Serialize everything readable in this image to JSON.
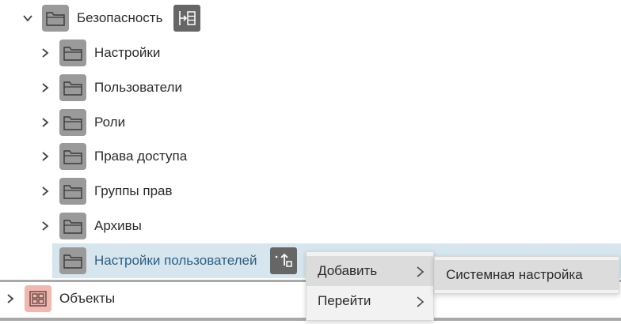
{
  "tree": {
    "root": {
      "label": "Безопасность"
    },
    "children": [
      {
        "label": "Настройки"
      },
      {
        "label": "Пользователи"
      },
      {
        "label": "Роли"
      },
      {
        "label": "Права доступа"
      },
      {
        "label": "Группы прав"
      },
      {
        "label": "Архивы"
      },
      {
        "label": "Настройки пользователей"
      }
    ],
    "objects": {
      "label": "Объекты"
    }
  },
  "context_menu": {
    "items": [
      {
        "label": "Добавить"
      },
      {
        "label": "Перейти"
      }
    ]
  },
  "submenu": {
    "items": [
      {
        "label": "Системная настройка"
      }
    ]
  },
  "colors": {
    "selection": "#d7e6ee",
    "selected_text": "#2c5f84",
    "folder_bg": "#9a9a9a",
    "objects_icon_bg": "#f0b8b0"
  },
  "icons": {
    "folder": "folder-icon",
    "expand": "chevron-right-icon",
    "collapse": "chevron-down-icon",
    "root_action": "tree-structure-icon",
    "selected_action": "add-item-icon",
    "objects": "objects-grid-icon"
  }
}
